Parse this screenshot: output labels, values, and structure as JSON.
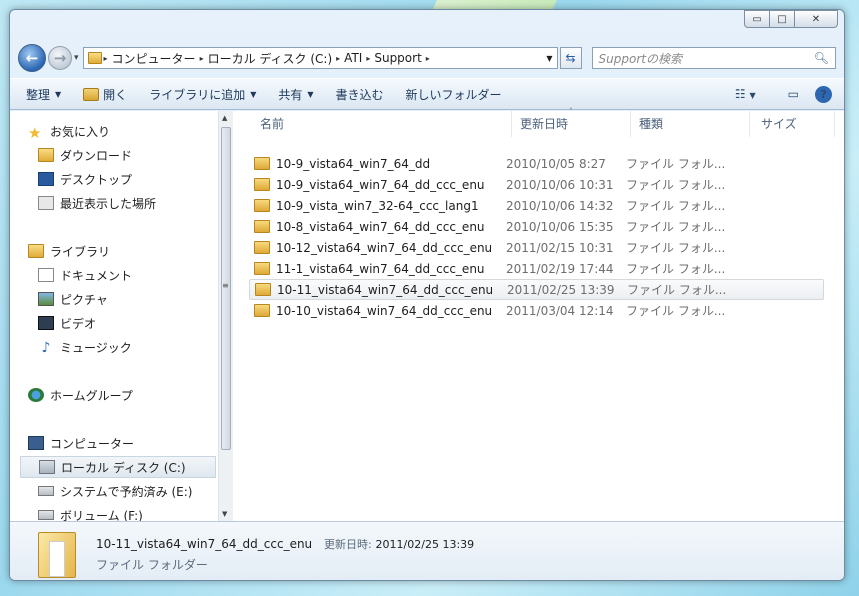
{
  "window": {
    "caption_buttons": [
      "▭",
      "□",
      "✕"
    ]
  },
  "address": {
    "segments": [
      "コンピューター",
      "ローカル ディスク (C:)",
      "ATI",
      "Support"
    ],
    "separator": "▸"
  },
  "search": {
    "placeholder": "Supportの検索"
  },
  "toolbar": {
    "organize": "整理",
    "open": "開く",
    "add_to_library": "ライブラリに追加",
    "share": "共有",
    "burn": "書き込む",
    "new_folder": "新しいフォルダー"
  },
  "nav": {
    "favorites": "お気に入り",
    "downloads": "ダウンロード",
    "desktop": "デスクトップ",
    "recent": "最近表示した場所",
    "libraries": "ライブラリ",
    "documents": "ドキュメント",
    "pictures": "ピクチャ",
    "videos": "ビデオ",
    "music": "ミュージック",
    "homegroup": "ホームグループ",
    "computer": "コンピューター",
    "local_disk": "ローカル ディスク (C:)",
    "reserved": "システムで予約済み (E:)",
    "volume": "ボリューム (F:)"
  },
  "columns": {
    "name": "名前",
    "date": "更新日時",
    "type": "種類",
    "size": "サイズ"
  },
  "files": [
    {
      "name": "10-9_vista64_win7_64_dd",
      "date": "2010/10/05 8:27",
      "type": "ファイル フォル..."
    },
    {
      "name": "10-9_vista64_win7_64_dd_ccc_enu",
      "date": "2010/10/06 10:31",
      "type": "ファイル フォル..."
    },
    {
      "name": "10-9_vista_win7_32-64_ccc_lang1",
      "date": "2010/10/06 14:32",
      "type": "ファイル フォル..."
    },
    {
      "name": "10-8_vista64_win7_64_dd_ccc_enu",
      "date": "2010/10/06 15:35",
      "type": "ファイル フォル..."
    },
    {
      "name": "10-12_vista64_win7_64_dd_ccc_enu",
      "date": "2011/02/15 10:31",
      "type": "ファイル フォル..."
    },
    {
      "name": "11-1_vista64_win7_64_dd_ccc_enu",
      "date": "2011/02/19 17:44",
      "type": "ファイル フォル..."
    },
    {
      "name": "10-11_vista64_win7_64_dd_ccc_enu",
      "date": "2011/02/25 13:39",
      "type": "ファイル フォル..."
    },
    {
      "name": "10-10_vista64_win7_64_dd_ccc_enu",
      "date": "2011/03/04 12:14",
      "type": "ファイル フォル..."
    }
  ],
  "details": {
    "name": "10-11_vista64_win7_64_dd_ccc_enu",
    "modified_label": "更新日時:",
    "modified_value": "2011/02/25 13:39",
    "type": "ファイル フォルダー"
  }
}
